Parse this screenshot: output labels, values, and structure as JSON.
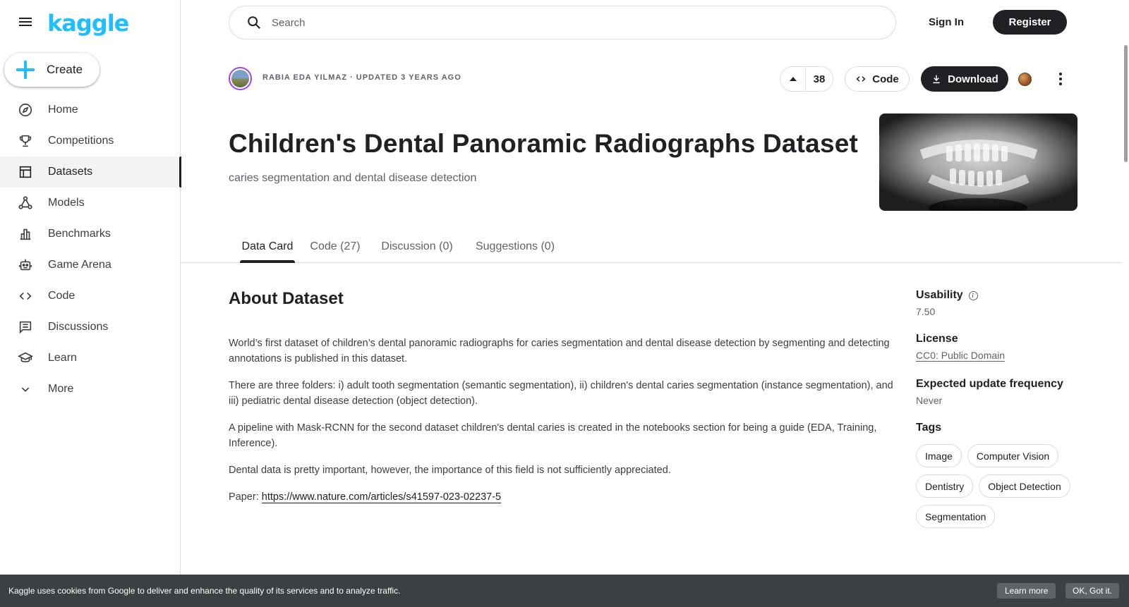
{
  "app": {
    "logo": "kaggle"
  },
  "sidebar": {
    "create_label": "Create",
    "items": [
      {
        "label": "Home",
        "icon": "compass-icon"
      },
      {
        "label": "Competitions",
        "icon": "trophy-icon"
      },
      {
        "label": "Datasets",
        "icon": "table-icon",
        "active": true
      },
      {
        "label": "Models",
        "icon": "models-icon"
      },
      {
        "label": "Benchmarks",
        "icon": "bar-chart-icon"
      },
      {
        "label": "Game Arena",
        "icon": "robot-icon"
      },
      {
        "label": "Code",
        "icon": "code-icon"
      },
      {
        "label": "Discussions",
        "icon": "comments-icon"
      },
      {
        "label": "Learn",
        "icon": "school-icon"
      },
      {
        "label": "More",
        "icon": "chevron-down-icon"
      }
    ]
  },
  "header": {
    "search_placeholder": "Search",
    "sign_in": "Sign In",
    "register": "Register"
  },
  "dataset": {
    "author": "RABIA EDA YILMAZ",
    "separator": "·",
    "updated": "UPDATED 3 YEARS AGO",
    "upvotes": "38",
    "code_label": "Code",
    "download_label": "Download",
    "title": "Children's Dental Panoramic Radiographs Dataset",
    "subtitle": "caries segmentation and dental disease detection"
  },
  "tabs": [
    {
      "label": "Data Card",
      "active": true
    },
    {
      "label": "Code (27)"
    },
    {
      "label": "Discussion (0)"
    },
    {
      "label": "Suggestions (0)"
    }
  ],
  "about": {
    "heading": "About Dataset",
    "paragraphs": [
      "World’s first dataset of children’s dental panoramic radiographs for caries segmentation and dental disease detection by segmenting and detecting annotations is published in this dataset.",
      "There are three folders: i) adult tooth segmentation (semantic segmentation), ii) children's dental caries segmentation (instance segmentation), and iii) pediatric dental disease detection (object detection).",
      "A pipeline with Mask-RCNN for the second dataset children's dental caries is created in the notebooks section for being a guide (EDA, Training, Inference).",
      "Dental data is pretty important, however, the importance of this field is not sufficiently appreciated."
    ],
    "paper_label": "Paper:",
    "paper_link": "https://www.nature.com/articles/s41597-023-02237-5"
  },
  "side": {
    "usability_label": "Usability",
    "usability_value": "7.50",
    "license_label": "License",
    "license_value": "CC0: Public Domain",
    "update_label": "Expected update frequency",
    "update_value": "Never",
    "tags_label": "Tags",
    "tags": [
      "Image",
      "Computer Vision",
      "Dentistry",
      "Object Detection",
      "Segmentation"
    ]
  },
  "cookie": {
    "text": "Kaggle uses cookies from Google to deliver and enhance the quality of its services and to analyze traffic.",
    "learn_more": "Learn more",
    "ok": "OK, Got it."
  }
}
